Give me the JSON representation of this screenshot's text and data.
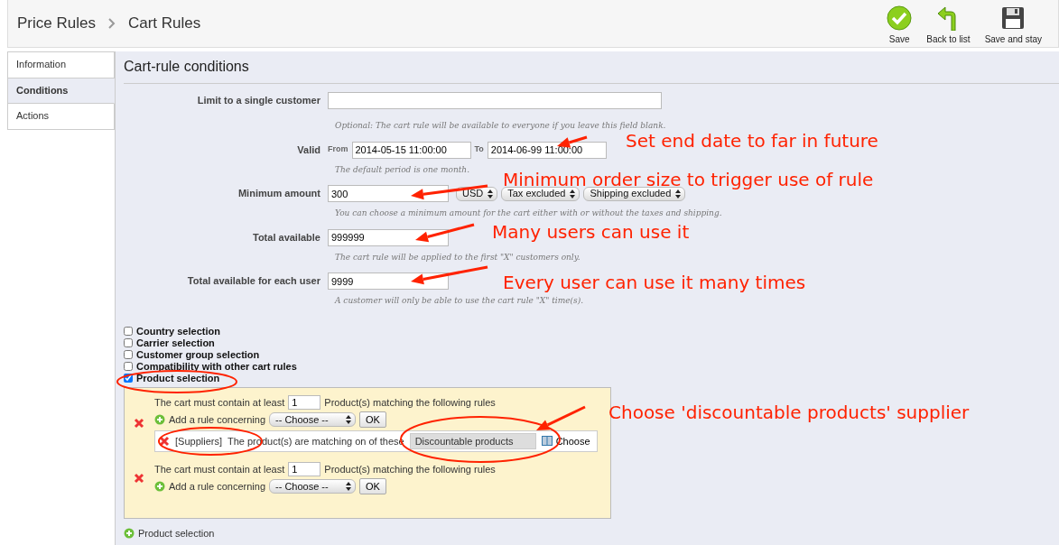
{
  "breadcrumb": [
    "Price Rules",
    "Cart Rules"
  ],
  "toolbar": [
    {
      "label": "Save",
      "kind": "save"
    },
    {
      "label": "Back to list",
      "kind": "back"
    },
    {
      "label": "Save and stay",
      "kind": "stay"
    }
  ],
  "tabs": [
    {
      "label": "Information",
      "selected": false
    },
    {
      "label": "Conditions",
      "selected": true
    },
    {
      "label": "Actions",
      "selected": false
    }
  ],
  "panel_title": "Cart-rule conditions",
  "fields": [
    {
      "kind": "text",
      "label": "Limit to a single customer",
      "help": "Optional: The cart rule will be available to everyone if you leave this field blank."
    },
    {
      "kind": "dates",
      "label": "Valid",
      "from_label": "From",
      "from_value": "2014-05-15 11:00:00",
      "to_label": "To",
      "to_value": "2014-06-99 11:00:00",
      "help": "The default period is one month."
    },
    {
      "kind": "amount",
      "label": "Minimum amount",
      "value": "300",
      "selects": [
        "USD",
        "Tax excluded",
        "Shipping excluded"
      ],
      "help": "You can choose a minimum amount for the cart either with or without the taxes and shipping."
    },
    {
      "kind": "number",
      "label": "Total available",
      "value": "999999",
      "help": "The cart rule will be applied to the first \"X\" customers only."
    },
    {
      "kind": "number",
      "label": "Total available for each user",
      "value": "9999",
      "help": "A customer will only be able to use the cart rule \"X\" time(s)."
    }
  ],
  "restrictions": [
    {
      "label": "Country selection",
      "checked": false
    },
    {
      "label": "Carrier selection",
      "checked": false
    },
    {
      "label": "Customer group selection",
      "checked": false
    },
    {
      "label": "Compatibility with other cart rules",
      "checked": false
    },
    {
      "label": "Product selection",
      "checked": true
    }
  ],
  "product_groups": [
    {
      "prefix": "The cart must contain at least",
      "quantity": "1",
      "suffix": "Product(s) matching the following rules",
      "add_label": "Add a rule concerning",
      "select": "-- Choose --",
      "ok": "OK",
      "rules": [
        {
          "type": "[Suppliers]",
          "text": "The product(s) are matching on of these",
          "value": "Discountable products",
          "choose": "Choose"
        }
      ]
    },
    {
      "prefix": "The cart must contain at least",
      "quantity": "1",
      "suffix": "Product(s) matching the following rules",
      "add_label": "Add a rule concerning",
      "select": "-- Choose --",
      "ok": "OK"
    }
  ],
  "add_product_selection": "Product selection",
  "annotations": [
    "Set end date to far in future",
    "Minimum order size to trigger use of rule",
    "Many users can use it",
    "Every user can use it many times",
    "Choose 'discountable products' supplier"
  ]
}
